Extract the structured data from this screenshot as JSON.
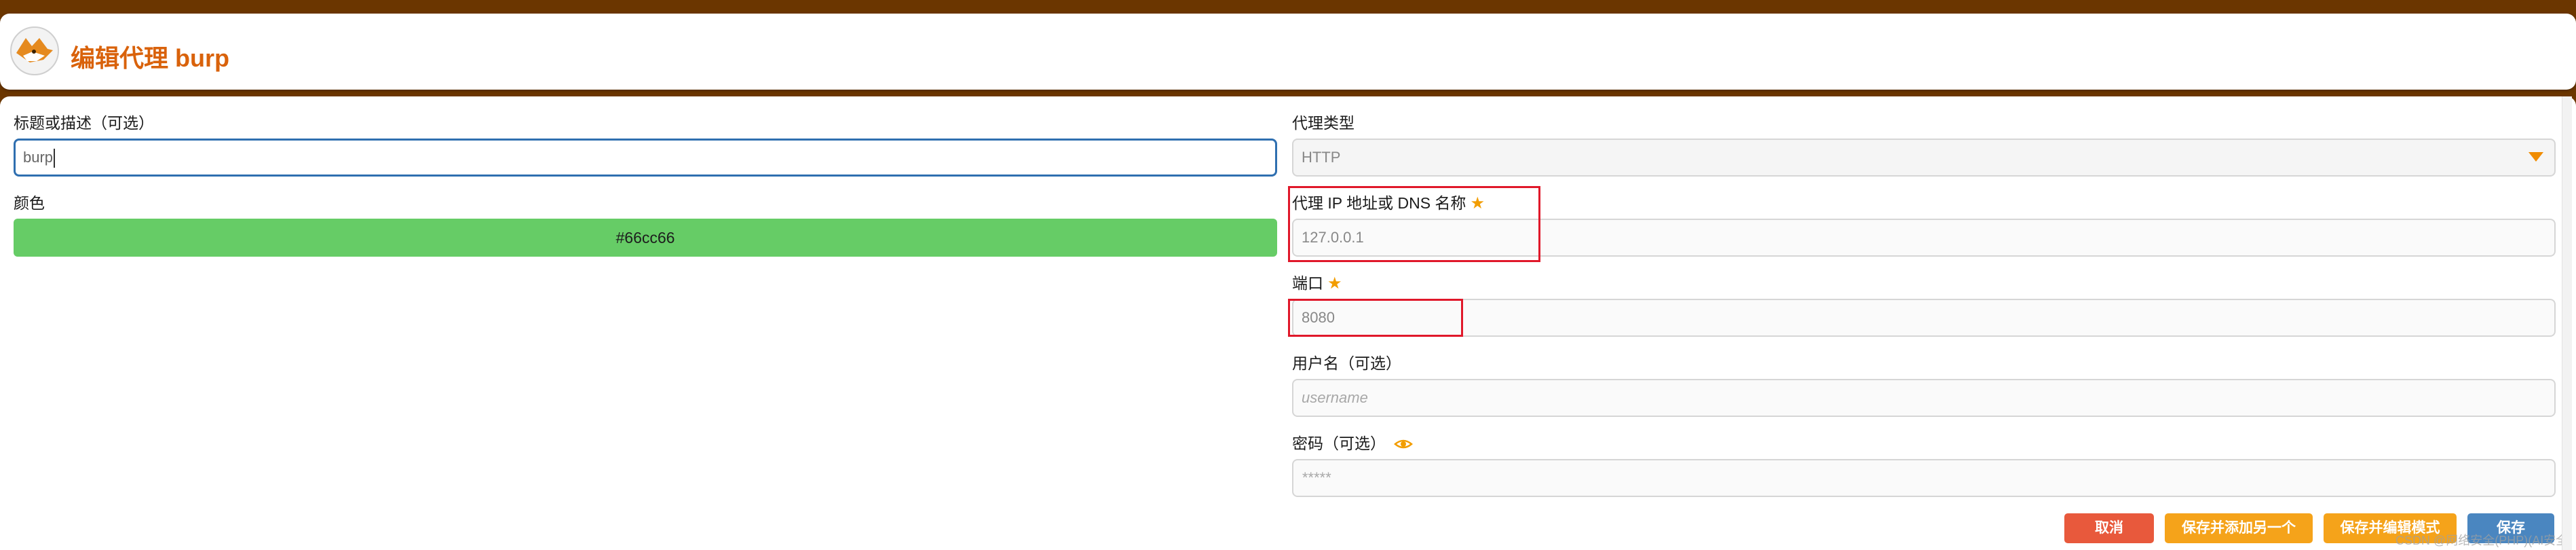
{
  "header": {
    "title": "编辑代理 burp",
    "logo_icon": "foxyproxy-fox-icon",
    "title_color": "#d9620b",
    "frame_color": "#6b3600"
  },
  "left": {
    "title_label": "标题或描述（可选）",
    "title_value": "burp",
    "color_label": "颜色",
    "color_value": "#66cc66"
  },
  "right": {
    "type_label": "代理类型",
    "type_value": "HTTP",
    "host_label": "代理 IP 地址或 DNS 名称",
    "host_value": "127.0.0.1",
    "port_label": "端口",
    "port_value": "8080",
    "username_label": "用户名（可选）",
    "username_placeholder": "username",
    "password_label": "密码（可选）",
    "password_placeholder": "*****",
    "required_icon": "star-icon",
    "password_visibility_icon": "eye-icon"
  },
  "buttons": {
    "cancel": "取消",
    "save_add_another": "保存并添加另一个",
    "save_edit_patterns": "保存并编辑模式",
    "save": "保存"
  },
  "colors": {
    "cancel": "#e8593c",
    "orange": "#f5a31a",
    "save": "#4a86c0",
    "highlight_box": "#e0182a"
  },
  "watermark": "CSDN @网络安全(PHP)(AI安全)"
}
